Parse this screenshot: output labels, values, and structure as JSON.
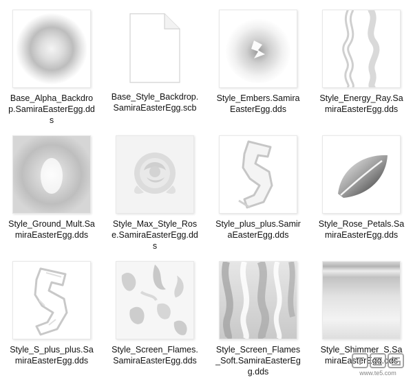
{
  "files": [
    {
      "name": "Base_Alpha_Backdrop.SamiraEasterEgg.dds",
      "icon": "radial-ring-icon"
    },
    {
      "name": "Base_Style_Backdrop.SamiraEasterEgg.scb",
      "icon": "blank-document-icon"
    },
    {
      "name": "Style_Embers.SamiraEasterEgg.dds",
      "icon": "ember-glow-icon"
    },
    {
      "name": "Style_Energy_Ray.SamiraEasterEgg.dds",
      "icon": "energy-ray-icon"
    },
    {
      "name": "Style_Ground_Mult.SamiraEasterEgg.dds",
      "icon": "soft-glow-icon"
    },
    {
      "name": "Style_Max_Style_Rose.SamiraEasterEgg.dds",
      "icon": "rose-icon"
    },
    {
      "name": "Style_plus_plus.SamiraEasterEgg.dds",
      "icon": "s-letter-icon"
    },
    {
      "name": "Style_Rose_Petals.SamiraEasterEgg.dds",
      "icon": "petal-icon"
    },
    {
      "name": "Style_S_plus_plus.SamiraEasterEgg.dds",
      "icon": "s-letter-outline-icon"
    },
    {
      "name": "Style_Screen_Flames.SamiraEasterEgg.dds",
      "icon": "flames-icon"
    },
    {
      "name": "Style_Screen_Flames_Soft.SamiraEasterEgg.dds",
      "icon": "soft-flames-icon"
    },
    {
      "name": "Style_Shimmer_S.SamiraEasterEgg.dds",
      "icon": "shimmer-gradient-icon"
    }
  ],
  "watermark": {
    "url": "www.te5.com"
  }
}
